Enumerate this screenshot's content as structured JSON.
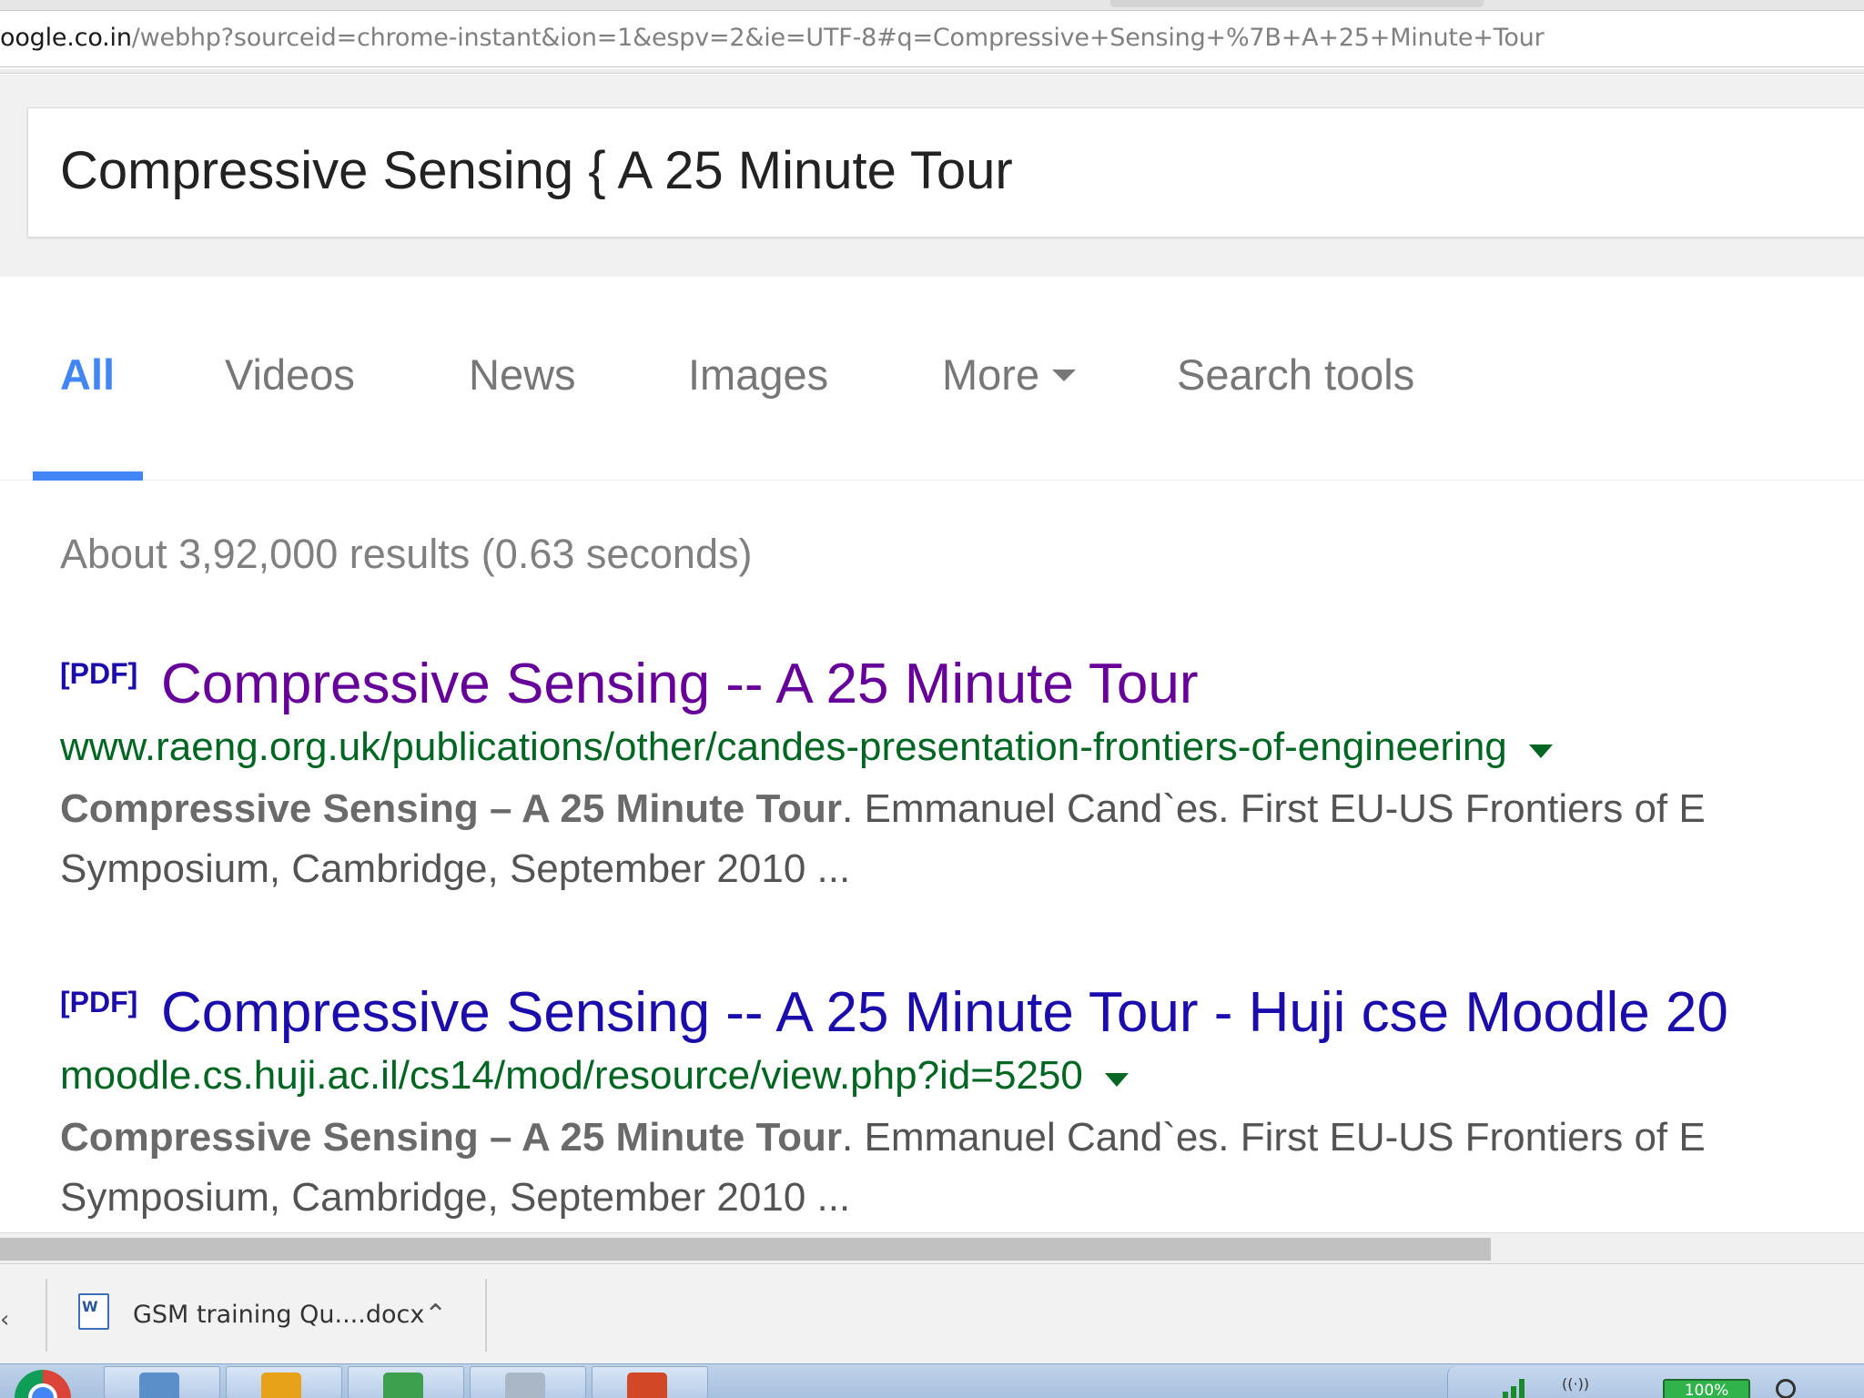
{
  "browser": {
    "url_host": "oogle.co.in",
    "url_path": "/webhp?sourceid=chrome-instant&ion=1&espv=2&ie=UTF-8#q=Compressive+Sensing+%7B+A+25+Minute+Tour"
  },
  "search": {
    "query": "Compressive Sensing { A 25 Minute Tour"
  },
  "tabs": [
    {
      "label": "All"
    },
    {
      "label": "Videos"
    },
    {
      "label": "News"
    },
    {
      "label": "Images"
    },
    {
      "label": "More"
    },
    {
      "label": "Search tools"
    }
  ],
  "stats": "About 3,92,000 results (0.63 seconds)",
  "results": [
    {
      "tag": "[PDF]",
      "title": "Compressive Sensing -- A 25 Minute Tour",
      "url": "www.raeng.org.uk/publications/other/candes-presentation-frontiers-of-engineering",
      "snippet_bold": "Compressive Sensing – A 25 Minute Tour",
      "snippet_rest": ". Emmanuel Cand`es. First EU-US Frontiers of E",
      "snippet_line2": "Symposium, Cambridge, September 2010 ..."
    },
    {
      "tag": "[PDF]",
      "title": "Compressive Sensing -- A 25 Minute Tour - Huji cse Moodle 20",
      "url": "moodle.cs.huji.ac.il/cs14/mod/resource/view.php?id=5250",
      "snippet_bold": "Compressive Sensing – A 25 Minute Tour",
      "snippet_rest": ". Emmanuel Cand`es. First EU-US Frontiers of E",
      "snippet_line2": "Symposium, Cambridge, September 2010 ..."
    }
  ],
  "downloads": {
    "file_name": "GSM training Qu....docx"
  },
  "taskbar": {
    "battery_label": "100%"
  },
  "colors": {
    "tab_active": "#4285f4",
    "visited_link": "#660099",
    "link": "#1a0dab",
    "url_green": "#006621"
  }
}
